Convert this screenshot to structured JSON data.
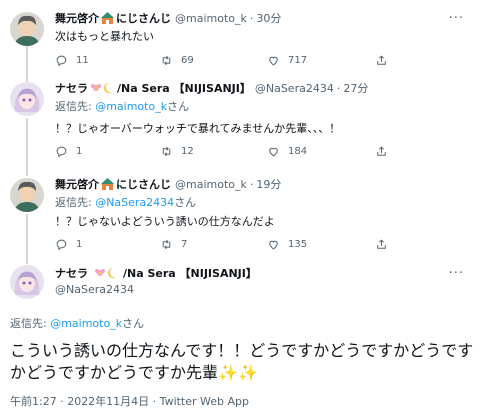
{
  "tweets": [
    {
      "name": "舞元啓介",
      "name_suffix": "にじさんじ",
      "handle": "@maimoto_k",
      "time": "30分",
      "text": "次はもっと暴れたい",
      "replies": "11",
      "retweets": "69",
      "likes": "717"
    },
    {
      "name": "ナセラ",
      "name_suffix": "/Na Sera 【NIJISANJI】",
      "handle": "@NaSera2434",
      "time": "27分",
      "reply_prefix": "返信先: ",
      "reply_mention": "@maimoto_k",
      "reply_suffix": "さん",
      "text": "！？じゃオーバーウォッチで暴れてみませんか先輩、、、！",
      "replies": "1",
      "retweets": "12",
      "likes": "184"
    },
    {
      "name": "舞元啓介",
      "name_suffix": "にじさんじ",
      "handle": "@maimoto_k",
      "time": "19分",
      "reply_prefix": "返信先: ",
      "reply_mention": "@NaSera2434",
      "reply_suffix": "さん",
      "text": "！？じゃないよどういう誘いの仕方なんだよ",
      "replies": "1",
      "retweets": "7",
      "likes": "135"
    }
  ],
  "main_tweet": {
    "name": "ナセラ",
    "name_suffix": "/Na Sera 【NIJISANJI】",
    "handle": "@NaSera2434",
    "reply_prefix": "返信先: ",
    "reply_mention": "@maimoto_k",
    "reply_suffix": "さん",
    "text": "こういう誘いの仕方なんです！！どうですかどうですかどうですかどうですかどうですか先輩",
    "sparkles": "✨✨",
    "meta": "午前1:27 · 2022年11月4日 · Twitter Web App"
  },
  "icons": [
    "more-icon",
    "reply-icon",
    "retweet-icon",
    "like-icon",
    "share-icon"
  ],
  "colors": {
    "link": "#1d9bf0",
    "muted": "#536471",
    "thread_line": "#cfd9de"
  }
}
